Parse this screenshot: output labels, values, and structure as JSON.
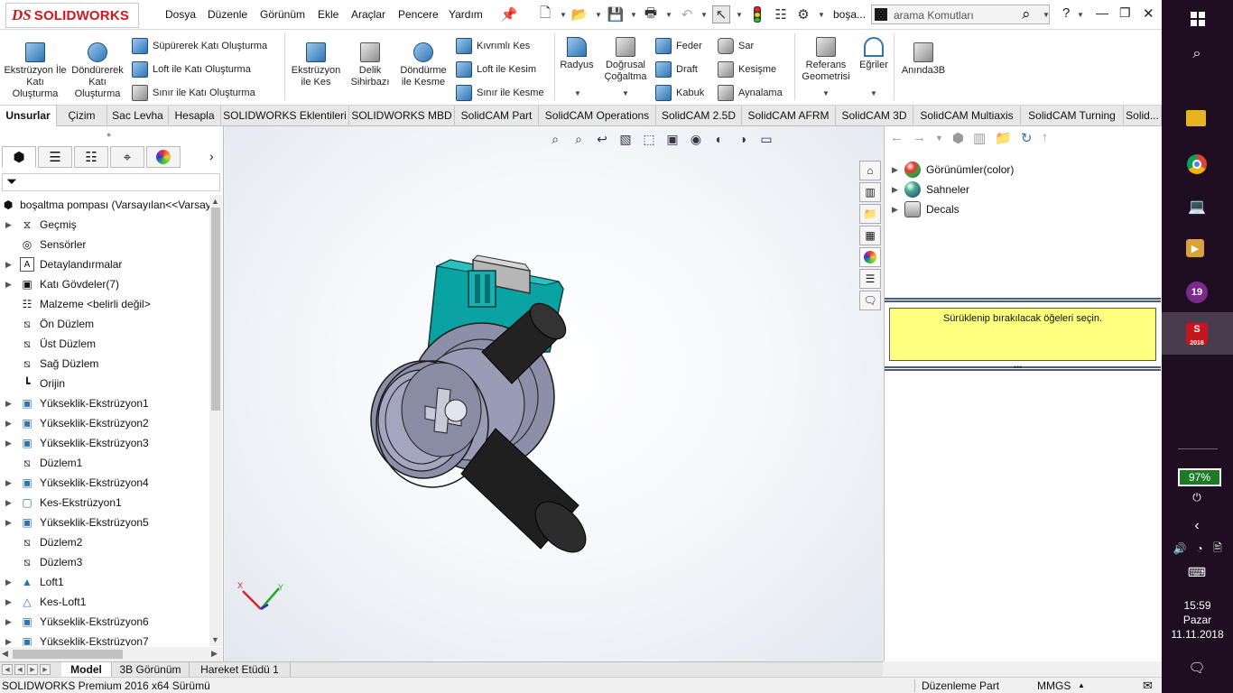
{
  "app": {
    "logo_prefix": "DS",
    "logo_text": "SOLIDWORKS"
  },
  "menu": {
    "items": [
      "Dosya",
      "Düzenle",
      "Görünüm",
      "Ekle",
      "Araçlar",
      "Pencere",
      "Yardım"
    ]
  },
  "titlebar": {
    "document": "boşa...",
    "search_placeholder": "arama Komutları",
    "help": "?"
  },
  "ribbon": {
    "extrude_boss": "Ekstrüzyon İle Katı Oluşturma",
    "revolve_boss": "Döndürerek Katı Oluşturma",
    "sweep_boss": "Süpürerek Katı Oluşturma",
    "loft_boss": "Loft ile Katı Oluşturma",
    "boundary_boss": "Sınır ile Katı Oluşturma",
    "extrude_cut": "Ekstrüzyon ile Kes",
    "hole_wizard": "Delik Sihirbazı",
    "revolve_cut": "Döndürme ile Kesme",
    "swept_cut": "Kıvrımlı Kes",
    "loft_cut": "Loft ile Kesim",
    "boundary_cut": "Sınır ile Kesme",
    "fillet": "Radyus",
    "linear_pattern": "Doğrusal Çoğaltma",
    "rib": "Feder",
    "draft": "Draft",
    "shell": "Kabuk",
    "wrap": "Sar",
    "intersect": "Kesişme",
    "mirror": "Aynalama",
    "ref_geometry": "Referans Geometrisi",
    "curves": "Eğriler",
    "instant3d": "Anında3B"
  },
  "tabs": [
    "Unsurlar",
    "Çizim",
    "Sac Levha",
    "Hesapla",
    "SOLIDWORKS Eklentileri",
    "SOLIDWORKS MBD",
    "SolidCAM Part",
    "SolidCAM Operations",
    "SolidCAM 2.5D",
    "SolidCAM AFRM",
    "SolidCAM 3D",
    "SolidCAM Multiaxis",
    "SolidCAM Turning",
    "Solid..."
  ],
  "tree": {
    "root": "boşaltma pompası  (Varsayılan<<Varsayılan>",
    "items": [
      "Geçmiş",
      "Sensörler",
      "Detaylandırmalar",
      "Katı Gövdeler(7)",
      "Malzeme <belirli değil>",
      "Ön Düzlem",
      "Üst Düzlem",
      "Sağ Düzlem",
      "Orijin",
      "Yükseklik-Ekstrüzyon1",
      "Yükseklik-Ekstrüzyon2",
      "Yükseklik-Ekstrüzyon3",
      "Düzlem1",
      "Yükseklik-Ekstrüzyon4",
      "Kes-Ekstrüzyon1",
      "Yükseklik-Ekstrüzyon5",
      "Düzlem2",
      "Düzlem3",
      "Loft1",
      "Kes-Loft1",
      "Yükseklik-Ekstrüzyon6",
      "Yükseklik-Ekstrüzyon7"
    ]
  },
  "triad": {
    "x": "X",
    "y": "Y"
  },
  "appearances": {
    "items": [
      "Görünümler(color)",
      "Sahneler",
      "Decals"
    ],
    "hint": "Sürüklenip bırakılacak öğeleri seçin."
  },
  "bottom_tabs": [
    "Model",
    "3B Görünüm",
    "Hareket Etüdü 1"
  ],
  "status": {
    "product": "SOLIDWORKS Premium 2016 x64 Sürümü",
    "mode": "Düzenleme Part",
    "units": "MMGS"
  },
  "taskbar": {
    "app_badge": "19",
    "sw_label": "2016",
    "battery": "97%",
    "time": "15:59",
    "day": "Pazar",
    "date": "11.11.2018"
  },
  "colors": {
    "accent": "#d2151e",
    "part_body": "#0a9e9e",
    "part_ring": "#8d8fa8",
    "hint_bg": "#ffff80",
    "taskbar_bg": "#1f0e22"
  }
}
